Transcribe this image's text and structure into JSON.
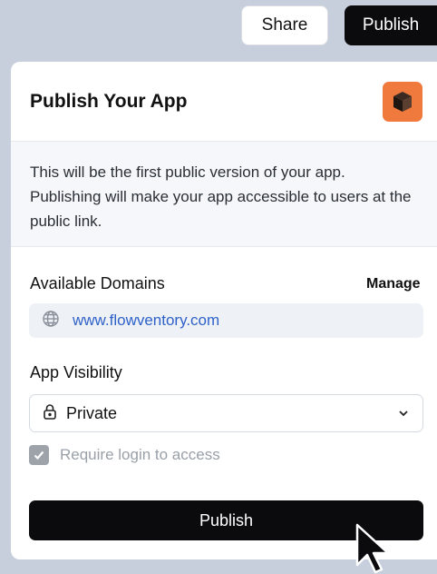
{
  "topbar": {
    "share_label": "Share",
    "publish_label": "Publish"
  },
  "dialog": {
    "title": "Publish Your App",
    "logo_icon": "cube-icon",
    "logo_color": "#f07a3e",
    "notice": "This will be the first public version of your app. Publishing will make your app accessible to users at the public link.",
    "domains": {
      "label": "Available Domains",
      "manage_label": "Manage",
      "icon": "globe-icon",
      "domain": "www.flowventory.com"
    },
    "visibility": {
      "label": "App Visibility",
      "icon": "lock-icon",
      "selected": "Private"
    },
    "require_login": {
      "label": "Require login to access",
      "checked": true
    },
    "publish_label": "Publish"
  }
}
